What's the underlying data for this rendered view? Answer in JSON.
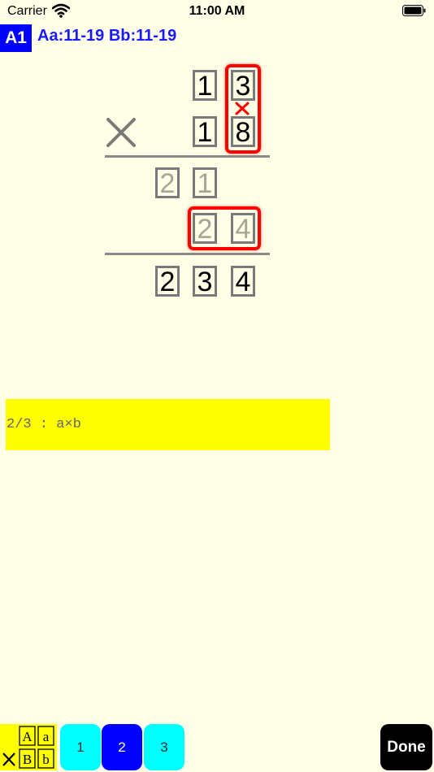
{
  "status_bar": {
    "carrier": "Carrier",
    "time": "11:00 AM"
  },
  "header": {
    "level": "A1",
    "range": "Aa:11-19 Bb:11-19"
  },
  "problem": {
    "multiplicand": [
      "1",
      "3"
    ],
    "multiplier": [
      "1",
      "8"
    ],
    "operator": "×",
    "partial_1": [
      "2",
      "1"
    ],
    "partial_2": [
      "2",
      "4"
    ],
    "product": [
      "2",
      "3",
      "4"
    ]
  },
  "hint": {
    "text": "2/3 : a×b"
  },
  "mode_icon": {
    "top_left": "A",
    "top_right": "a",
    "bottom_left": "B",
    "bottom_right": "b",
    "operator": "×"
  },
  "pages": {
    "items": [
      "1",
      "2",
      "3"
    ],
    "selected": "2"
  },
  "done_label": "Done",
  "colors": {
    "background": "#fffee6",
    "accent_blue": "#0000ff",
    "highlight_red": "#ff0000",
    "hint_yellow": "#ffff00",
    "page_cyan": "#00ffff"
  }
}
